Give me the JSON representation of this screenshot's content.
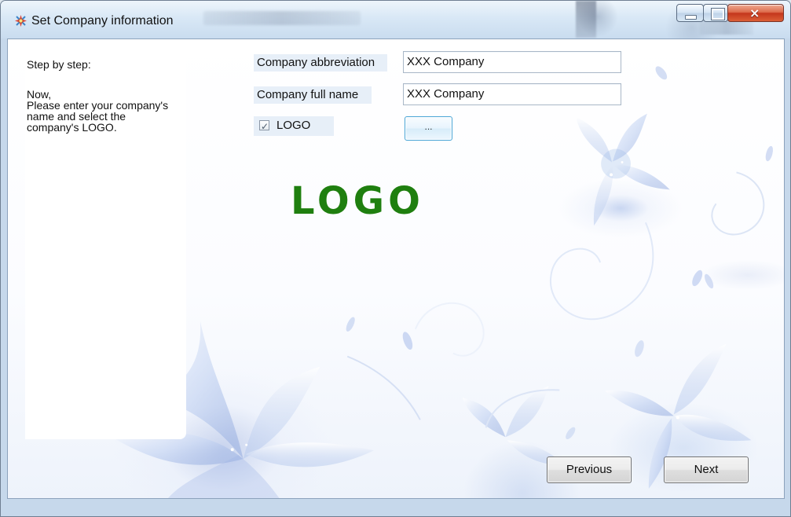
{
  "window": {
    "title": "Set Company information",
    "icon": "company-settings-icon",
    "controls": {
      "minimize": "minimize-icon",
      "maximize": "maximize-icon",
      "close": "close-icon"
    }
  },
  "left_panel": {
    "title": "Step by step:",
    "instructions": "Now,\nPlease enter your company's\nname and select the\ncompany's LOGO."
  },
  "form": {
    "company_abbreviation": {
      "label": "Company abbreviation",
      "value": "XXX Company"
    },
    "company_full_name": {
      "label": "Company full name",
      "value": "XXX Company"
    },
    "logo_checkbox": {
      "label": "LOGO",
      "checked": true
    },
    "browse_button_label": "..."
  },
  "preview": {
    "logo_text": "LOGO",
    "logo_color": "#1f7f0f"
  },
  "navigation": {
    "previous_label": "Previous",
    "next_label": "Next"
  }
}
